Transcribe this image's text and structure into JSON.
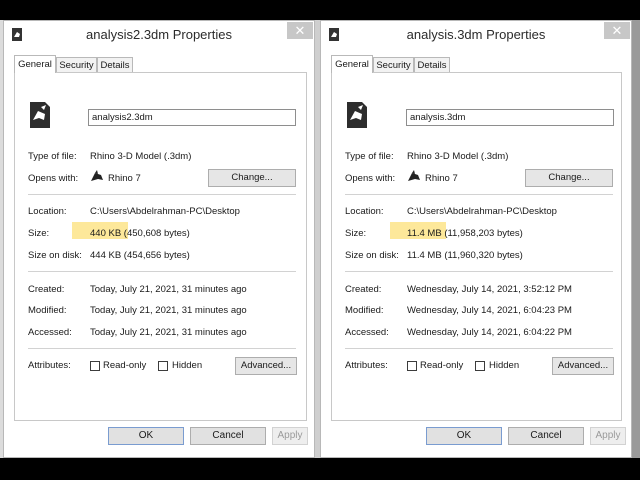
{
  "dialogs": [
    {
      "title": "analysis2.3dm Properties",
      "tabs": [
        "General",
        "Security",
        "Details"
      ],
      "filename": "analysis2.3dm",
      "labels": {
        "type": "Type of file:",
        "opens": "Opens with:",
        "location": "Location:",
        "size": "Size:",
        "size_on_disk": "Size on disk:",
        "created": "Created:",
        "modified": "Modified:",
        "accessed": "Accessed:",
        "attributes": "Attributes:"
      },
      "type_of_file": "Rhino 3-D Model (.3dm)",
      "opens_with": "Rhino 7",
      "change_label": "Change...",
      "location": "C:\\Users\\Abdelrahman-PC\\Desktop",
      "size": "440 KB (450,608 bytes)",
      "size_on_disk": "444 KB (454,656 bytes)",
      "created": "Today, July 21, 2021, 31 minutes ago",
      "modified": "Today, July 21, 2021, 31 minutes ago",
      "accessed": "Today, July 21, 2021, 31 minutes ago",
      "readonly_label": "Read-only",
      "hidden_label": "Hidden",
      "advanced_label": "Advanced...",
      "ok_label": "OK",
      "cancel_label": "Cancel",
      "apply_label": "Apply"
    },
    {
      "title": "analysis.3dm Properties",
      "tabs": [
        "General",
        "Security",
        "Details"
      ],
      "filename": "analysis.3dm",
      "labels": {
        "type": "Type of file:",
        "opens": "Opens with:",
        "location": "Location:",
        "size": "Size:",
        "size_on_disk": "Size on disk:",
        "created": "Created:",
        "modified": "Modified:",
        "accessed": "Accessed:",
        "attributes": "Attributes:"
      },
      "type_of_file": "Rhino 3-D Model (.3dm)",
      "opens_with": "Rhino 7",
      "change_label": "Change...",
      "location": "C:\\Users\\Abdelrahman-PC\\Desktop",
      "size": "11.4 MB (11,958,203 bytes)",
      "size_on_disk": "11.4 MB (11,960,320 bytes)",
      "created": "Wednesday, July 14, 2021, 3:52:12 PM",
      "modified": "Wednesday, July 14, 2021, 6:04:23 PM",
      "accessed": "Wednesday, July 14, 2021, 6:04:22 PM",
      "readonly_label": "Read-only",
      "hidden_label": "Hidden",
      "advanced_label": "Advanced...",
      "ok_label": "OK",
      "cancel_label": "Cancel",
      "apply_label": "Apply"
    }
  ],
  "colors": {
    "highlight": "#fde89a",
    "close_button": "#c7c7c7",
    "button_face": "#e6e6e6"
  },
  "icons": [
    "rhino-file-icon",
    "rhino-app-icon",
    "close-icon"
  ]
}
